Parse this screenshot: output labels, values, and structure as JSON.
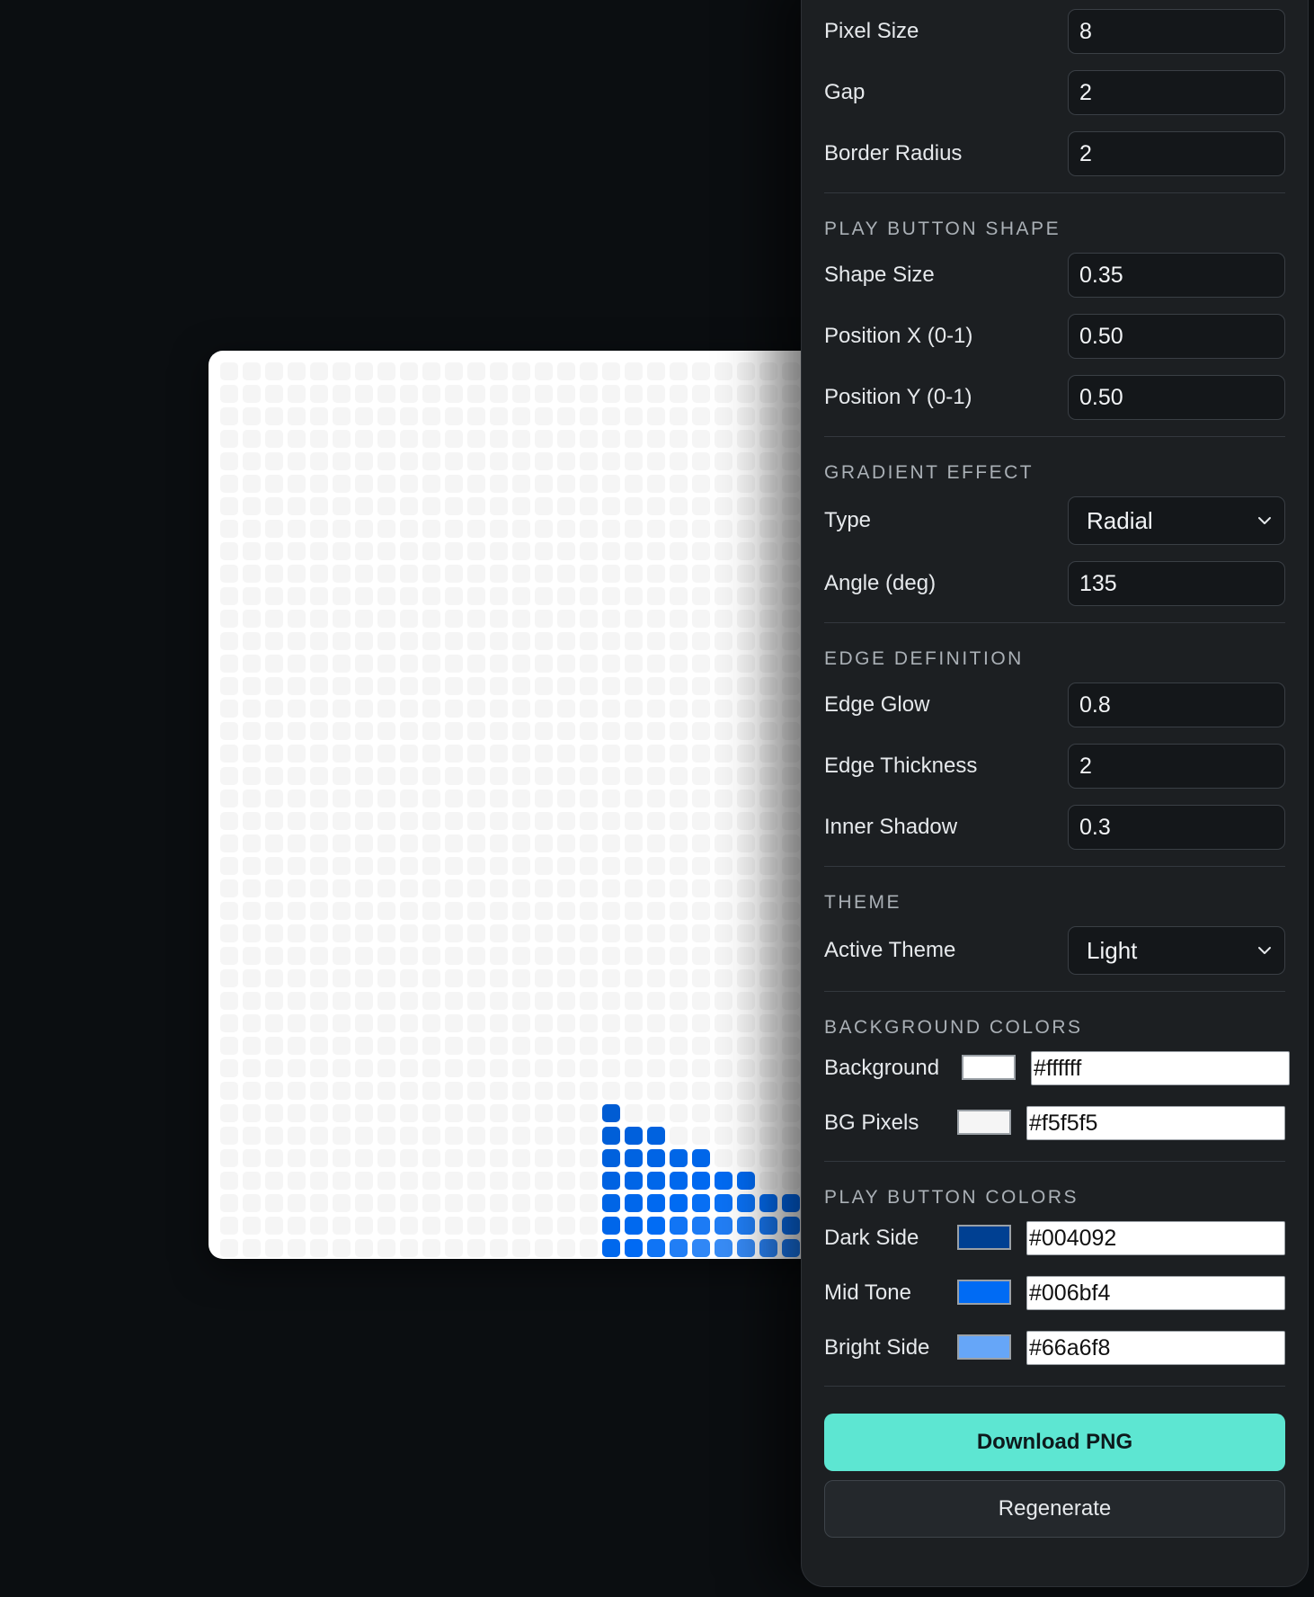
{
  "settings": {
    "pixel_size": {
      "label": "Pixel Size",
      "value": "8"
    },
    "gap": {
      "label": "Gap",
      "value": "2"
    },
    "border_radius": {
      "label": "Border Radius",
      "value": "2"
    },
    "play_shape": {
      "title": "PLAY BUTTON SHAPE",
      "shape_size": {
        "label": "Shape Size",
        "value": "0.35"
      },
      "position_x": {
        "label": "Position X (0-1)",
        "value": "0.50"
      },
      "position_y": {
        "label": "Position Y (0-1)",
        "value": "0.50"
      }
    },
    "gradient": {
      "title": "GRADIENT EFFECT",
      "type": {
        "label": "Type",
        "value": "Radial"
      },
      "angle": {
        "label": "Angle (deg)",
        "value": "135"
      }
    },
    "edge": {
      "title": "EDGE DEFINITION",
      "edge_glow": {
        "label": "Edge Glow",
        "value": "0.8"
      },
      "edge_thickness": {
        "label": "Edge Thickness",
        "value": "2"
      },
      "inner_shadow": {
        "label": "Inner Shadow",
        "value": "0.3"
      }
    },
    "theme": {
      "title": "THEME",
      "active_theme": {
        "label": "Active Theme",
        "value": "Light"
      }
    },
    "background_colors": {
      "title": "BACKGROUND COLORS",
      "background": {
        "label": "Background",
        "hex": "#ffffff"
      },
      "bg_pixels": {
        "label": "BG Pixels",
        "hex": "#f5f5f5"
      }
    },
    "play_colors": {
      "title": "PLAY BUTTON COLORS",
      "dark_side": {
        "label": "Dark Side",
        "hex": "#004092"
      },
      "mid_tone": {
        "label": "Mid Tone",
        "hex": "#006bf4"
      },
      "bright_side": {
        "label": "Bright Side",
        "hex": "#66a6f8"
      }
    }
  },
  "actions": {
    "download_label": "Download PNG",
    "regenerate_label": "Regenerate"
  },
  "icons": {
    "select_chevron": "chevron-down-icon"
  },
  "colors": {
    "page_background": "#0b0e11",
    "panel_background": "#1c1f22",
    "accent": "#5de6d2"
  }
}
